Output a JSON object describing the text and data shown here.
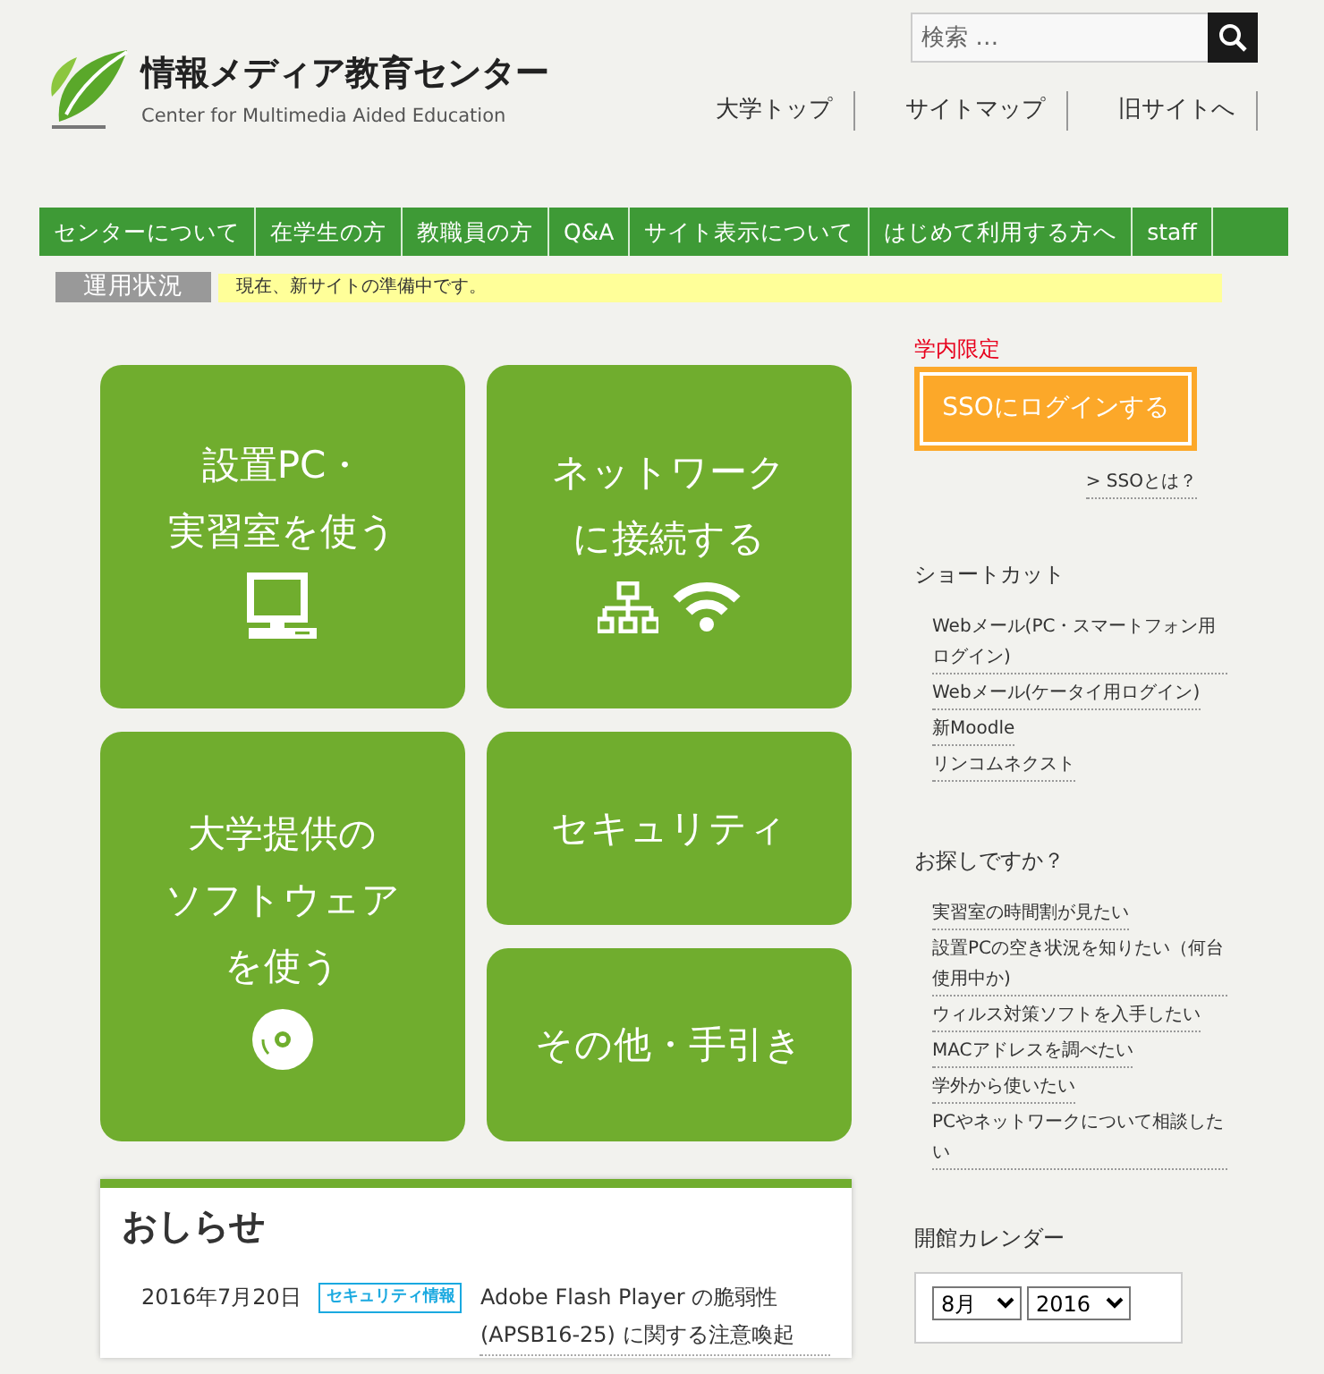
{
  "header": {
    "title": "情報メディア教育センター",
    "subtitle": "Center for Multimedia Aided Education",
    "search": {
      "placeholder": "検索 …"
    },
    "top_links": [
      "大学トップ",
      "サイトマップ",
      "旧サイトへ"
    ]
  },
  "nav": [
    "センターについて",
    "在学生の方",
    "教職員の方",
    "Q&A",
    "サイト表示について",
    "はじめて利用する方へ",
    "staff"
  ],
  "status": {
    "label": "運用状況",
    "text": "現在、新サイトの準備中です。"
  },
  "tiles": [
    {
      "lines": [
        "設置PC・",
        "実習室を使う"
      ],
      "kind": "computer"
    },
    {
      "lines": [
        "ネットワーク",
        "に接続する"
      ],
      "kind": "network"
    },
    {
      "lines": [
        "大学提供の",
        "ソフトウェア",
        "を使う"
      ],
      "kind": "software"
    },
    {
      "lines": [
        "セキュリティ"
      ],
      "kind": "plain"
    },
    {
      "lines": [
        "その他・手引き"
      ],
      "kind": "plain"
    }
  ],
  "news": {
    "title": "おしらせ",
    "items": [
      {
        "date": "2016年7月20日",
        "tag": "セキュリティ情報",
        "text": "Adobe Flash Player の脆弱性 (APSB16-25) に関する注意喚起"
      }
    ]
  },
  "sidebar": {
    "restricted_label": "学内限定",
    "sso_button": "SSOにログインする",
    "sso_link": "> SSOとは？",
    "shortcuts": {
      "title": "ショートカット",
      "links": [
        "Webメール(PC・スマートフォン用ログイン)",
        "Webメール(ケータイ用ログイン)",
        "新Moodle",
        "リンコムネクスト"
      ]
    },
    "looking_for": {
      "title": "お探しですか？",
      "links": [
        "実習室の時間割が見たい",
        "設置PCの空き状況を知りたい（何台使用中か)",
        "ウィルス対策ソフトを入手したい",
        "MACアドレスを調べたい",
        "学外から使いたい",
        "PCやネットワークについて相談したい"
      ]
    },
    "calendar": {
      "title": "開館カレンダー",
      "month": "8月",
      "year": "2016"
    }
  }
}
